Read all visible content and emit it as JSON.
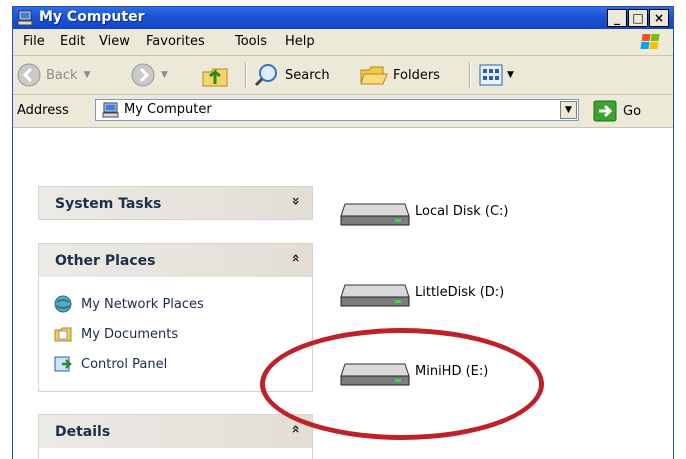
{
  "window": {
    "title": "My Computer",
    "controls": [
      "_",
      "□",
      "×"
    ]
  },
  "menubar": {
    "items": [
      "File",
      "Edit",
      "View",
      "Favorites",
      "Tools",
      "Help"
    ]
  },
  "toolbar": {
    "back_label": "Back",
    "search_label": "Search",
    "folders_label": "Folders"
  },
  "address": {
    "label": "Address",
    "value": "My Computer",
    "go_label": "Go"
  },
  "tasks": {
    "system_tasks": {
      "title": "System Tasks",
      "chevron": "»"
    },
    "other_places": {
      "title": "Other Places",
      "chevron": "«",
      "items": [
        "My Network Places",
        "My Documents",
        "Control Panel"
      ]
    },
    "details": {
      "title": "Details",
      "chevron": "«"
    }
  },
  "drives": [
    {
      "label": "Local Disk (C:)"
    },
    {
      "label": "LittleDisk (D:)"
    },
    {
      "label": "MiniHD (E:)"
    }
  ],
  "colors": {
    "title_bar": "#1b55d6",
    "chrome": "#ece9d8",
    "highlight_circle": "#c0202a"
  }
}
